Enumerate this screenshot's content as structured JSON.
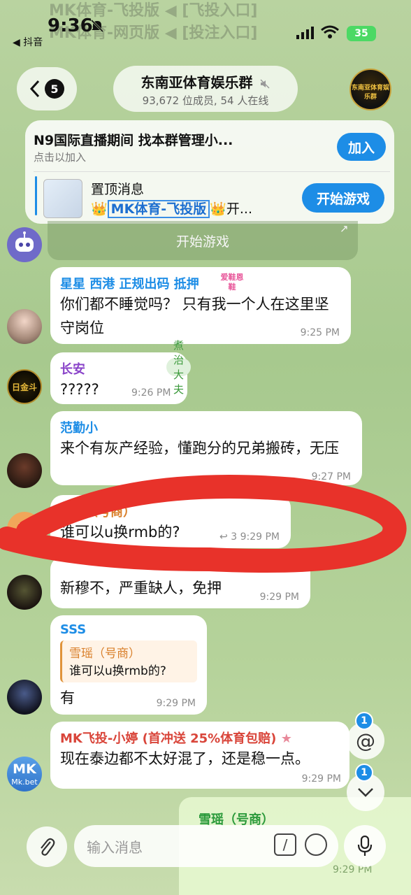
{
  "status_bar": {
    "time": "9:36",
    "back_app": "◀ 抖音",
    "battery": "35"
  },
  "faded_banner": {
    "line1": "MK体育-飞投版 ◀ [飞投入口]",
    "line2": "MK体育-网页版 ◀ [投注入口]"
  },
  "header": {
    "back_count": "5",
    "title": "东南亚体育娱乐群",
    "subtitle": "93,672 位成员, 54 人在线",
    "avatar_text": "东南亚体育娱乐群"
  },
  "promo": {
    "title": "N9国际直播期间 找本群管理小...",
    "subtitle": "点击以加入",
    "join_label": "加入"
  },
  "pinned": {
    "label": "置顶消息",
    "text_prefix": "👑",
    "text_highlight": "MK体育-飞投版",
    "text_suffix": "👑开...",
    "play_label": "开始游戏"
  },
  "game_bar": {
    "label": "开始游戏"
  },
  "messages": [
    {
      "name": "星星 西港 正规出码 抵押",
      "tag": "爱鞋恩鞋",
      "text": "你们都不睡觉吗？ 只有我一个人在这里坚守岗位",
      "time": "9:25 PM"
    },
    {
      "name": "长安",
      "rank": "煮治大夫",
      "text": "?????",
      "time": "9:26 PM"
    },
    {
      "name": "范勤小",
      "text": "来个有灰产经验，懂跑分的兄弟搬砖，无压",
      "time": "9:27 PM"
    },
    {
      "name": "雪瑶（号商）",
      "text": "谁可以u换rmb的?",
      "replies": "3",
      "time": "9:29 PM"
    },
    {
      "text": "新穆不，严重缺人，免押",
      "time": "9:29 PM"
    },
    {
      "name": "SSS",
      "quote_name": "雪瑶（号商）",
      "quote_text": "谁可以u换rmb的?",
      "text": "有",
      "time": "9:29 PM"
    },
    {
      "name": "MK飞投-小婷 (首冲送 25%体育包赔)",
      "text": "现在泰边都不太好混了，还是稳一点。",
      "time": "9:29 PM"
    }
  ],
  "avatars": {
    "xue": "雪",
    "mk_top": "MK",
    "mk_bottom": "Mk.bet",
    "gold": "日金斗"
  },
  "floating": {
    "mention_badge": "1",
    "down_badge": "1"
  },
  "self_message": {
    "name": "雪瑶（号商）",
    "time": "9:29 PM"
  },
  "composer": {
    "placeholder": "输入消息"
  },
  "colors": {
    "accent": "#1d8de6",
    "scribble": "#e8322a"
  }
}
